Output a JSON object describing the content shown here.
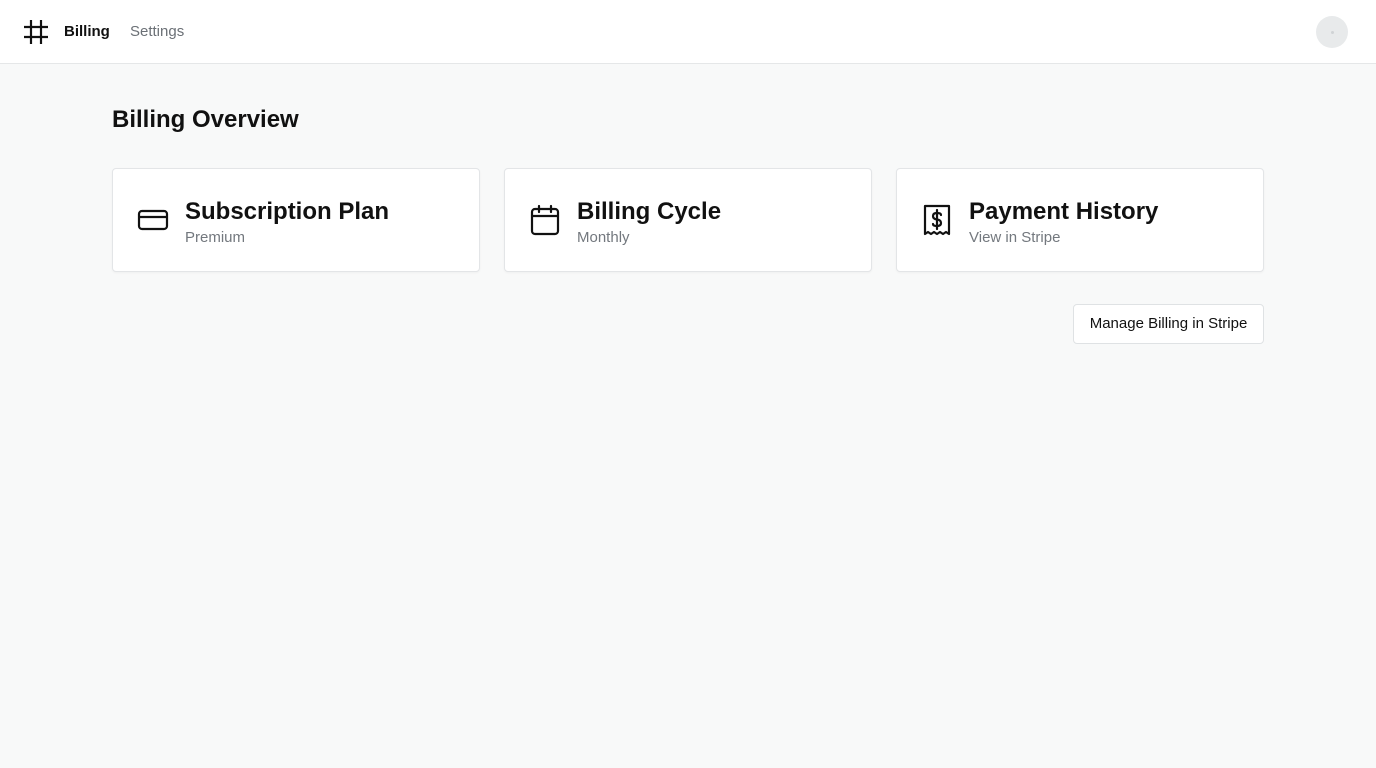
{
  "nav": {
    "logo_icon": "hash-icon",
    "links": [
      {
        "label": "Billing",
        "active": true
      },
      {
        "label": "Settings",
        "active": false
      }
    ]
  },
  "page": {
    "title": "Billing Overview"
  },
  "cards": [
    {
      "icon": "credit-card-icon",
      "title": "Subscription Plan",
      "subtitle": "Premium"
    },
    {
      "icon": "calendar-icon",
      "title": "Billing Cycle",
      "subtitle": "Monthly"
    },
    {
      "icon": "receipt-dollar-icon",
      "title": "Payment History",
      "subtitle": "View in Stripe"
    }
  ],
  "actions": {
    "manage_label": "Manage Billing in Stripe"
  },
  "colors": {
    "background": "#f8f9f9",
    "surface": "#ffffff",
    "text": "#111111",
    "muted_text": "#73787e",
    "border": "#e3e5e7"
  }
}
